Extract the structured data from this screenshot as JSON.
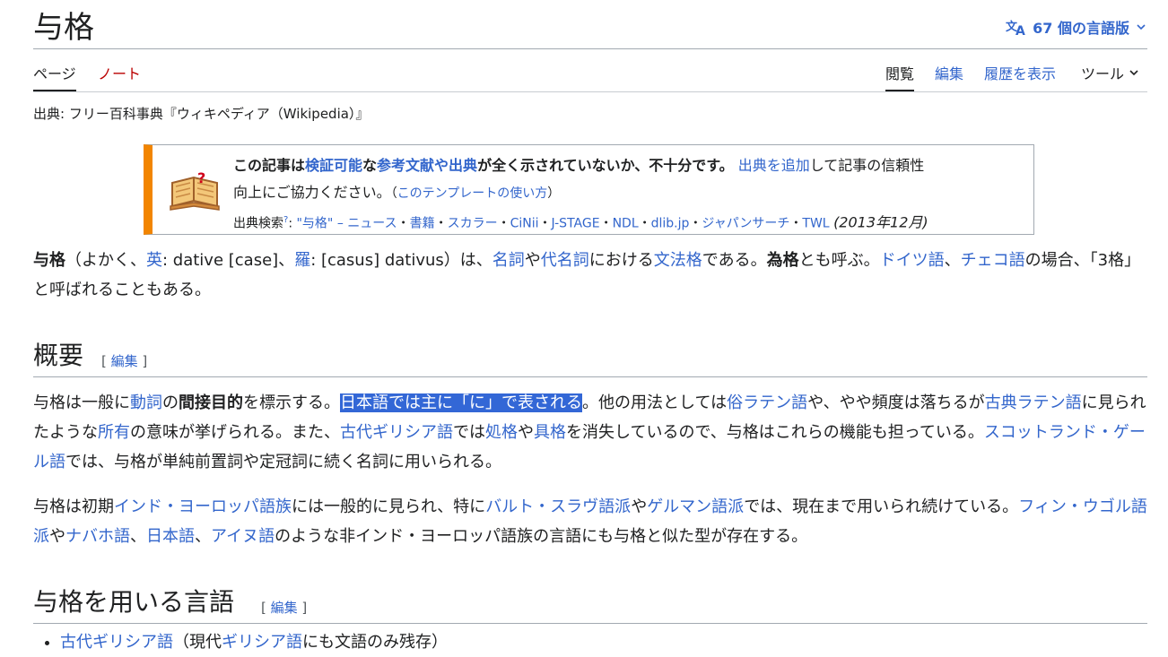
{
  "header": {
    "title": "与格",
    "languages_label": "67 個の言語版"
  },
  "tabs": {
    "page": "ページ",
    "note": "ノート",
    "read": "閲覧",
    "edit": "編集",
    "history": "履歴を表示",
    "tools": "ツール"
  },
  "site_sub": "出典: フリー百科事典『ウィキペディア（Wikipedia）』",
  "ambox": {
    "l1_a": "この記事は",
    "l1_b": "検証可能",
    "l1_c": "な",
    "l1_d": "参考文献や出典",
    "l1_e": "が全く示されていないか、不十分です。",
    "l1_f": "出典を追加",
    "l1_g": "して記事の信頼性",
    "l2_a": "向上にご協力ください。",
    "l2_b": "（",
    "l2_c": "このテンプレートの使い方",
    "l2_d": "）",
    "l3_label": "出典検索",
    "l3_sup": "?",
    "l3_colon": ": ",
    "l3_links": [
      "\"与格\" – ニュース",
      "書籍",
      "スカラー",
      "CiNii",
      "J-STAGE",
      "NDL",
      "dlib.jp",
      "ジャパンサーチ",
      "TWL"
    ],
    "l3_sep": "・",
    "l3_date": "(2013年12月)"
  },
  "intro": {
    "t1": "与格",
    "t2": "（よかく、",
    "t3": "英",
    "t4": ": dative [case]、",
    "t5": "羅",
    "t6": ": [casus] dativus）は、",
    "t7": "名詞",
    "t8": "や",
    "t9": "代名詞",
    "t10": "における",
    "t11": "文法格",
    "t12": "である。",
    "t13": "為格",
    "t14": "とも呼ぶ。",
    "t15": "ドイツ語",
    "t16": "、",
    "t17": "チェコ語",
    "t18": "の場合、「3格」と呼ばれることもある。"
  },
  "section1": {
    "title": "概要",
    "edit_open": "[ ",
    "edit_label": "編集",
    "edit_close": " ]"
  },
  "p1": {
    "a": "与格は一般に",
    "b": "動詞",
    "c": "の",
    "d": "間接目的",
    "e": "を標示する。",
    "f": "日本語では主に「に」で表される",
    "g": "。他の用法としては",
    "h": "俗ラテン語",
    "i": "や、やや頻度は落ちるが",
    "j": "古典ラテン語",
    "k": "に見られたような",
    "l": "所有",
    "m": "の意味が挙げられる。また、",
    "n": "古代ギリシア語",
    "o": "では",
    "p": "処格",
    "q": "や",
    "r": "具格",
    "s": "を消失しているので、与格はこれらの機能も担っている。",
    "t": "スコットランド・ゲール語",
    "u": "では、与格が単純前置詞や定冠詞に続く名詞に用いられる。"
  },
  "p2": {
    "a": "与格は初期",
    "b": "インド・ヨーロッパ語族",
    "c": "には一般的に見られ、特に",
    "d": "バルト・スラヴ語派",
    "e": "や",
    "f": "ゲルマン語派",
    "g": "では、現在まで用いられ続けている。",
    "h": "フィン・ウゴル語派",
    "i": "や",
    "j": "ナバホ語",
    "k": "、",
    "l": "日本語",
    "m": "、",
    "n": "アイヌ語",
    "o": "のような非インド・ヨーロッパ語族の言語にも与格と似た型が存在する。"
  },
  "section2": {
    "title": "与格を用いる言語",
    "edit_open": "[ ",
    "edit_label": "編集",
    "edit_close": " ]"
  },
  "list": {
    "item1_a": "古代ギリシア語",
    "item1_b": "（現代",
    "item1_c": "ギリシア語",
    "item1_d": "にも文語のみ残存）"
  }
}
